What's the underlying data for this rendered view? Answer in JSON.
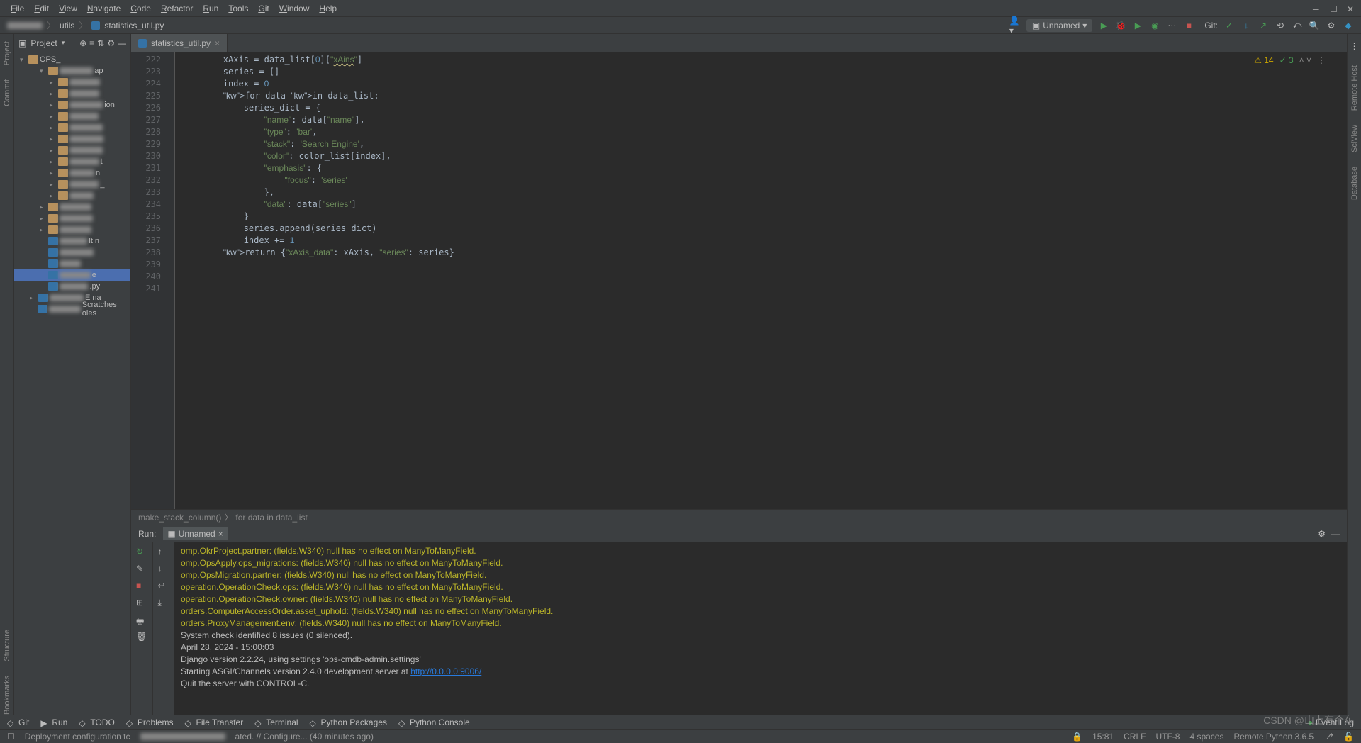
{
  "menu": [
    "File",
    "Edit",
    "View",
    "Navigate",
    "Code",
    "Refactor",
    "Run",
    "Tools",
    "Git",
    "Window",
    "Help"
  ],
  "breadcrumb": {
    "folder": "utils",
    "file": "statistics_util.py"
  },
  "run_config": "Unnamed",
  "git_label": "Git:",
  "project_panel": {
    "title": "Project",
    "root": "OPS_"
  },
  "tree_items": [
    {
      "label": "ap",
      "indent": 2,
      "folder": true,
      "arrow": "▾"
    },
    {
      "label": "",
      "indent": 3,
      "folder": true,
      "arrow": "▸"
    },
    {
      "label": "",
      "indent": 3,
      "folder": true,
      "arrow": "▸"
    },
    {
      "label": "ion",
      "indent": 3,
      "folder": true,
      "arrow": "▸"
    },
    {
      "label": "",
      "indent": 3,
      "folder": true,
      "arrow": "▸"
    },
    {
      "label": "",
      "indent": 3,
      "folder": true,
      "arrow": "▸"
    },
    {
      "label": "",
      "indent": 3,
      "folder": true,
      "arrow": "▸"
    },
    {
      "label": "",
      "indent": 3,
      "folder": true,
      "arrow": "▸"
    },
    {
      "label": "t",
      "indent": 3,
      "folder": true,
      "arrow": "▸"
    },
    {
      "label": "n",
      "indent": 3,
      "folder": true,
      "arrow": "▸"
    },
    {
      "label": "_",
      "indent": 3,
      "folder": true,
      "arrow": "▸"
    },
    {
      "label": "",
      "indent": 3,
      "folder": true,
      "arrow": "▸"
    },
    {
      "label": "",
      "indent": 2,
      "folder": true,
      "arrow": "▸"
    },
    {
      "label": "",
      "indent": 2,
      "folder": true,
      "arrow": "▸"
    },
    {
      "label": "",
      "indent": 2,
      "folder": true,
      "arrow": "▸"
    },
    {
      "label": "lt    n",
      "indent": 2,
      "folder": false
    },
    {
      "label": "",
      "indent": 2,
      "folder": false
    },
    {
      "label": "",
      "indent": 2,
      "folder": false
    },
    {
      "label": "e",
      "indent": 2,
      "folder": false,
      "selected": true
    },
    {
      "label": ".py",
      "indent": 2,
      "folder": false
    },
    {
      "label": "E   na",
      "indent": 1,
      "folder": false,
      "arrow": "▸"
    },
    {
      "label": "Scratches          oles",
      "indent": 1,
      "folder": false
    }
  ],
  "tab": {
    "name": "statistics_util.py"
  },
  "inspections": {
    "warnings": "14",
    "weak": "3"
  },
  "code_start_line": 222,
  "code_lines": [
    "        xAxis = data_list[0][\"xAins\"]",
    "        series = []",
    "        index = 0",
    "        for data in data_list:",
    "            series_dict = {",
    "                \"name\": data[\"name\"],",
    "                \"type\": 'bar',",
    "                \"stack\": 'Search Engine',",
    "                \"color\": color_list[index],",
    "                \"emphasis\": {",
    "                    \"focus\": 'series'",
    "                },",
    "                \"data\": data[\"series\"]",
    "            }",
    "            series.append(series_dict)",
    "            index += 1",
    "        return {\"xAxis_data\": xAxis, \"series\": series}",
    "",
    "",
    ""
  ],
  "crumbs": [
    "make_stack_column()",
    "for data in data_list"
  ],
  "run_label": "Run:",
  "run_tab": "Unnamed",
  "console_lines": [
    {
      "t": "omp.OkrProject.partner: (fields.W340) null has no effect on ManyToManyField.",
      "c": "warn"
    },
    {
      "t": "omp.OpsApply.ops_migrations: (fields.W340) null has no effect on ManyToManyField.",
      "c": "warn"
    },
    {
      "t": "omp.OpsMigration.partner: (fields.W340) null has no effect on ManyToManyField.",
      "c": "warn"
    },
    {
      "t": "operation.OperationCheck.ops: (fields.W340) null has no effect on ManyToManyField.",
      "c": "warn"
    },
    {
      "t": "operation.OperationCheck.owner: (fields.W340) null has no effect on ManyToManyField.",
      "c": "warn"
    },
    {
      "t": "orders.ComputerAccessOrder.asset_uphold: (fields.W340) null has no effect on ManyToManyField.",
      "c": "warn"
    },
    {
      "t": "orders.ProxyManagement.env: (fields.W340) null has no effect on ManyToManyField.",
      "c": "warn"
    },
    {
      "t": "",
      "c": ""
    },
    {
      "t": "System check identified 8 issues (0 silenced).",
      "c": ""
    },
    {
      "t": "April 28, 2024 - 15:00:03",
      "c": ""
    },
    {
      "t": "Django version 2.2.24, using settings 'ops-cmdb-admin.settings'",
      "c": ""
    },
    {
      "t": "Starting ASGI/Channels version 2.4.0 development server at ",
      "c": "",
      "link": "http://0.0.0.0:9006/"
    },
    {
      "t": "Quit the server with CONTROL-C.",
      "c": ""
    }
  ],
  "bottom_tabs": [
    "Git",
    "Run",
    "TODO",
    "Problems",
    "File Transfer",
    "Terminal",
    "Python Packages",
    "Python Console"
  ],
  "event_log": "Event Log",
  "status": {
    "left": "Deployment configuration tc",
    "mid": "ated. // Configure... (40 minutes ago)",
    "pos": "15:81",
    "lf": "CRLF",
    "enc": "UTF-8",
    "indent": "4 spaces",
    "interp": "Remote Python 3.6.5"
  },
  "left_rail": [
    "Commit",
    "Project"
  ],
  "left_rail2": [
    "Structure",
    "Bookmarks"
  ],
  "right_rail": [
    "Remote Host",
    "SciView",
    "Database"
  ],
  "watermark": "CSDN @山上有个车"
}
